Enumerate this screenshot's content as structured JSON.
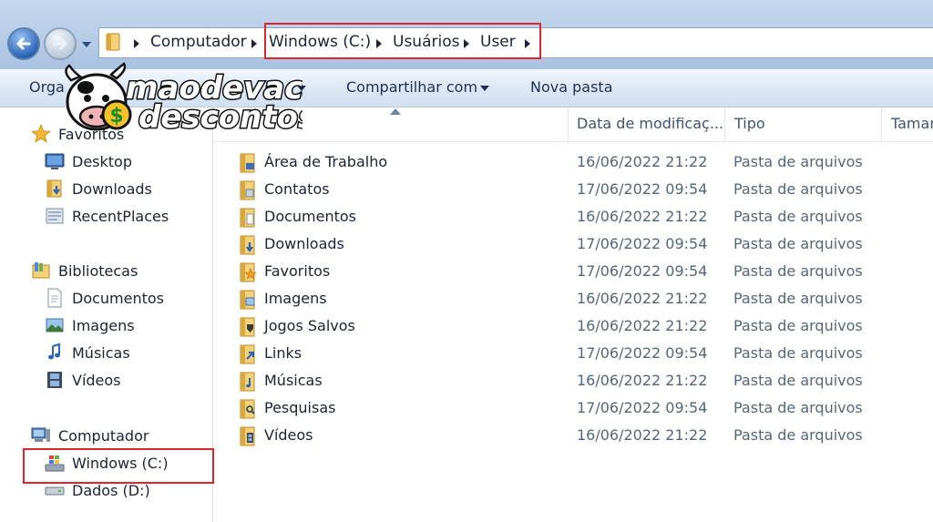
{
  "address_bar": {
    "breadcrumbs": [
      "Computador",
      "Windows (C:)",
      "Usuários",
      "User"
    ]
  },
  "toolbar": {
    "organize_label": "Orga",
    "share_label": "Compartilhar com",
    "new_folder_label": "Nova pasta"
  },
  "watermark": {
    "line1": "maodevaca",
    "line2": "descontos"
  },
  "sidebar": {
    "favorites": {
      "label": "Favoritos",
      "items": [
        "Desktop",
        "Downloads",
        "RecentPlaces"
      ]
    },
    "libraries": {
      "label": "Bibliotecas",
      "items": [
        "Documentos",
        "Imagens",
        "Músicas",
        "Vídeos"
      ]
    },
    "computer": {
      "label": "Computador",
      "items": [
        "Windows (C:)",
        "Dados (D:)"
      ]
    }
  },
  "columns": {
    "date": "Data de modificaç...",
    "type": "Tipo",
    "size": "Tamar"
  },
  "files": [
    {
      "name": "Área de Trabalho",
      "date": "16/06/2022 21:22",
      "type": "Pasta de arquivos",
      "icon": "desktop-folder-icon"
    },
    {
      "name": "Contatos",
      "date": "17/06/2022 09:54",
      "type": "Pasta de arquivos",
      "icon": "contacts-folder-icon"
    },
    {
      "name": "Documentos",
      "date": "16/06/2022 21:22",
      "type": "Pasta de arquivos",
      "icon": "documents-folder-icon"
    },
    {
      "name": "Downloads",
      "date": "17/06/2022 09:54",
      "type": "Pasta de arquivos",
      "icon": "downloads-folder-icon"
    },
    {
      "name": "Favoritos",
      "date": "17/06/2022 09:54",
      "type": "Pasta de arquivos",
      "icon": "favorites-folder-icon"
    },
    {
      "name": "Imagens",
      "date": "16/06/2022 21:22",
      "type": "Pasta de arquivos",
      "icon": "pictures-folder-icon"
    },
    {
      "name": "Jogos Salvos",
      "date": "16/06/2022 21:22",
      "type": "Pasta de arquivos",
      "icon": "saved-games-folder-icon"
    },
    {
      "name": "Links",
      "date": "17/06/2022 09:54",
      "type": "Pasta de arquivos",
      "icon": "links-folder-icon"
    },
    {
      "name": "Músicas",
      "date": "16/06/2022 21:22",
      "type": "Pasta de arquivos",
      "icon": "music-folder-icon"
    },
    {
      "name": "Pesquisas",
      "date": "17/06/2022 09:54",
      "type": "Pasta de arquivos",
      "icon": "searches-folder-icon"
    },
    {
      "name": "Vídeos",
      "date": "16/06/2022 21:22",
      "type": "Pasta de arquivos",
      "icon": "videos-folder-icon"
    }
  ],
  "colors": {
    "highlight": "#e0242c",
    "folder": "#e8b84a",
    "accent": "#2a64b8"
  }
}
